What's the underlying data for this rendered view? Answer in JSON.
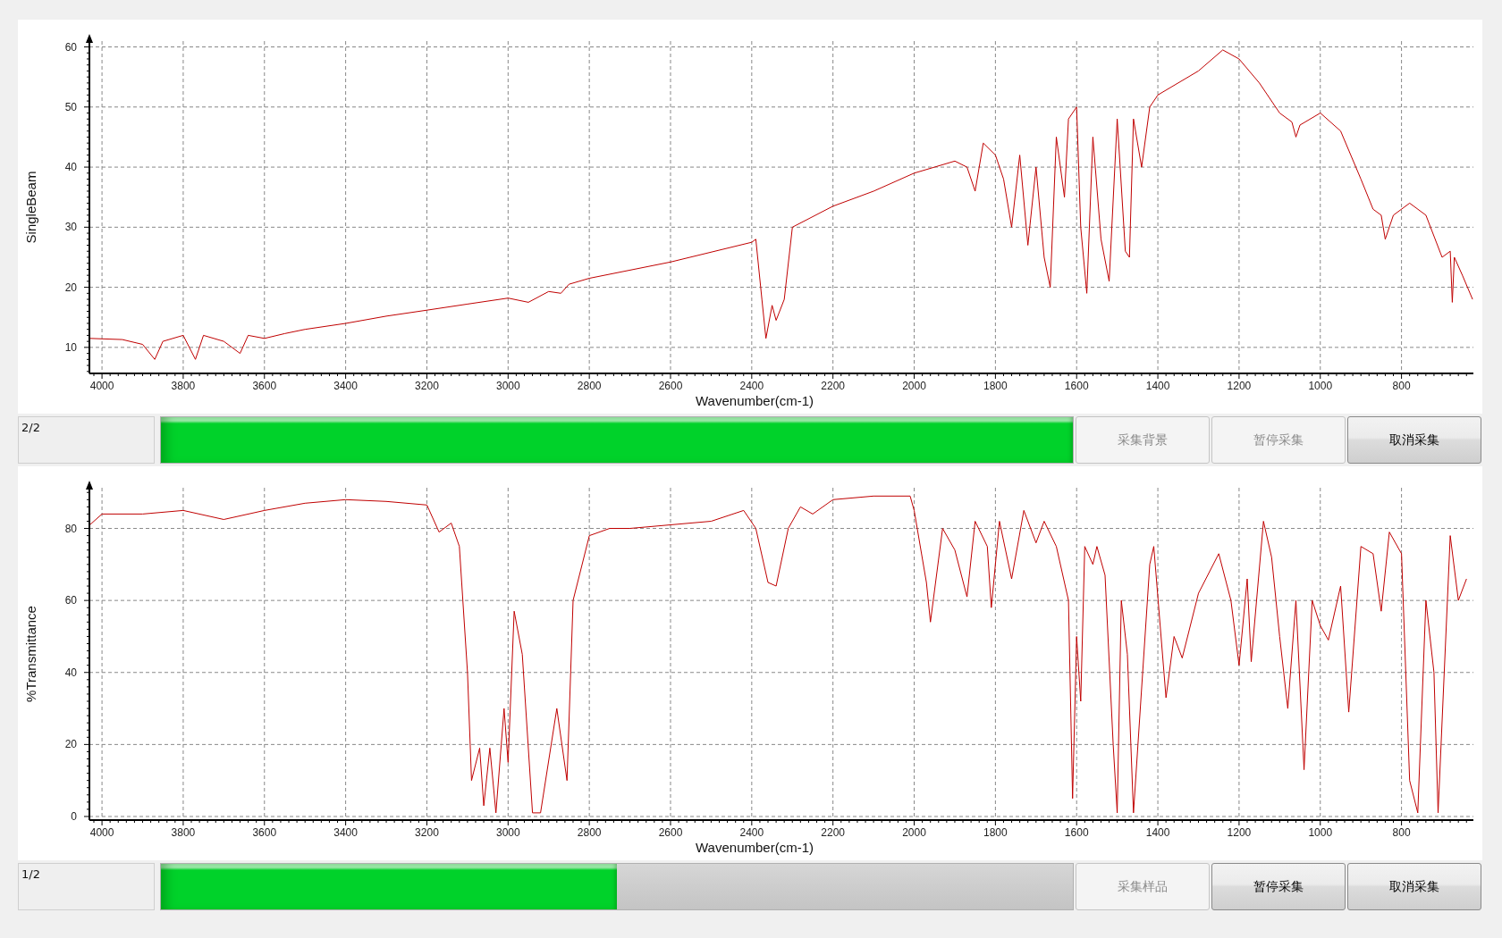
{
  "panels": [
    {
      "chart_data": {
        "type": "line",
        "grid": true,
        "xlabel": "Wavenumber(cm-1)",
        "ylabel": "SingleBeam",
        "xlim": [
          4031,
          623
        ],
        "ylim": [
          5.67,
          60.97
        ],
        "xticks": [
          4000,
          3800,
          3600,
          3400,
          3200,
          3000,
          2800,
          2600,
          2400,
          2200,
          2000,
          1800,
          1600,
          1400,
          1200,
          1000,
          800
        ],
        "yticks": [
          10,
          20,
          30,
          40,
          50,
          60
        ],
        "x": [
          4030,
          3950,
          3900,
          3870,
          3850,
          3800,
          3770,
          3750,
          3700,
          3660,
          3640,
          3600,
          3550,
          3500,
          3400,
          3300,
          3200,
          3100,
          3000,
          2950,
          2900,
          2870,
          2850,
          2800,
          2600,
          2400,
          2390,
          2375,
          2365,
          2350,
          2340,
          2320,
          2300,
          2200,
          2100,
          2000,
          1950,
          1900,
          1870,
          1850,
          1830,
          1800,
          1780,
          1760,
          1740,
          1720,
          1700,
          1680,
          1665,
          1650,
          1630,
          1620,
          1600,
          1590,
          1575,
          1560,
          1540,
          1520,
          1500,
          1480,
          1470,
          1460,
          1440,
          1420,
          1400,
          1300,
          1240,
          1200,
          1150,
          1100,
          1070,
          1060,
          1050,
          1000,
          950,
          900,
          870,
          850,
          840,
          820,
          780,
          740,
          700,
          680,
          675,
          670,
          650,
          625
        ],
        "series": [
          {
            "color": "#c00000",
            "values": [
              11.5,
              11.3,
              10.5,
              8,
              11,
              12,
              8,
              12,
              11,
              9,
              12,
              11.5,
              12.3,
              13,
              14,
              15.2,
              16.2,
              17.2,
              18.2,
              17.5,
              19.3,
              19,
              20.5,
              21.5,
              24.2,
              27.5,
              28,
              18,
              11.5,
              17,
              14.5,
              18,
              30,
              33.5,
              36,
              39,
              40,
              41,
              40,
              36,
              44,
              42,
              38,
              30,
              42,
              27,
              40,
              25,
              20,
              45,
              35,
              48,
              50,
              30,
              19,
              45,
              28,
              21,
              48,
              26,
              25,
              48,
              40,
              50,
              52,
              56,
              59.5,
              58,
              54,
              49,
              47.5,
              45,
              47,
              49,
              46,
              38,
              33,
              32,
              28,
              32,
              34,
              32,
              25,
              26,
              17.5,
              25,
              22,
              18
            ]
          }
        ]
      },
      "progress": {
        "label": "2/2",
        "level": 1.0
      },
      "buttons": [
        {
          "label": "采集背景",
          "disabled": true
        },
        {
          "label": "暂停采集",
          "disabled": true
        },
        {
          "label": "取消采集",
          "disabled": false
        }
      ]
    },
    {
      "chart_data": {
        "type": "line",
        "grid": true,
        "xlabel": "Wavenumber(cm-1)",
        "ylabel": "%Transmittance",
        "xlim": [
          4031,
          623
        ],
        "ylim": [
          -1.0,
          91.3
        ],
        "xticks": [
          4000,
          3800,
          3600,
          3400,
          3200,
          3000,
          2800,
          2600,
          2400,
          2200,
          2000,
          1800,
          1600,
          1400,
          1200,
          1000,
          800
        ],
        "yticks": [
          0,
          20,
          40,
          60,
          80
        ],
        "x": [
          4030,
          4000,
          3900,
          3800,
          3700,
          3600,
          3500,
          3400,
          3300,
          3200,
          3170,
          3140,
          3120,
          3100,
          3090,
          3070,
          3060,
          3045,
          3030,
          3010,
          3000,
          2985,
          2965,
          2940,
          2920,
          2880,
          2855,
          2840,
          2800,
          2750,
          2700,
          2600,
          2500,
          2420,
          2390,
          2360,
          2340,
          2310,
          2280,
          2250,
          2200,
          2100,
          2010,
          2000,
          1970,
          1960,
          1930,
          1900,
          1870,
          1850,
          1820,
          1810,
          1790,
          1760,
          1730,
          1700,
          1680,
          1650,
          1620,
          1610,
          1600,
          1590,
          1580,
          1560,
          1550,
          1530,
          1510,
          1500,
          1490,
          1475,
          1460,
          1420,
          1410,
          1380,
          1360,
          1340,
          1300,
          1250,
          1220,
          1200,
          1180,
          1170,
          1140,
          1120,
          1100,
          1080,
          1060,
          1040,
          1020,
          1000,
          980,
          950,
          930,
          900,
          870,
          850,
          830,
          800,
          780,
          760,
          740,
          720,
          710,
          680,
          660,
          640
        ],
        "series": [
          {
            "color": "#c00000",
            "values": [
              81,
              84,
              84,
              85,
              82.5,
              85,
              87,
              88,
              87.5,
              86.5,
              79,
              81.5,
              75,
              40,
              10,
              19,
              3,
              19,
              1,
              30,
              15,
              57,
              45,
              1,
              1,
              30,
              10,
              60,
              78,
              80,
              80,
              81,
              82,
              85,
              80,
              65,
              64,
              80,
              86,
              84,
              88,
              89,
              89,
              85,
              65,
              54,
              80,
              74,
              61,
              82,
              75,
              58,
              82,
              66,
              85,
              76,
              82,
              75,
              60,
              5,
              50,
              32,
              75,
              70,
              75,
              67,
              20,
              1,
              60,
              45,
              1,
              70,
              75,
              33,
              50,
              44,
              62,
              73,
              60,
              42,
              66,
              43,
              82,
              72,
              50,
              30,
              60,
              13,
              60,
              53,
              49,
              64,
              29,
              75,
              73,
              57,
              79,
              73,
              10,
              1,
              60,
              40,
              1,
              78,
              60,
              66
            ]
          }
        ]
      },
      "progress": {
        "label": "1/2",
        "level": 0.5
      },
      "buttons": [
        {
          "label": "采集样品",
          "disabled": true
        },
        {
          "label": "暂停采集",
          "disabled": false
        },
        {
          "label": "取消采集",
          "disabled": false
        }
      ]
    }
  ]
}
